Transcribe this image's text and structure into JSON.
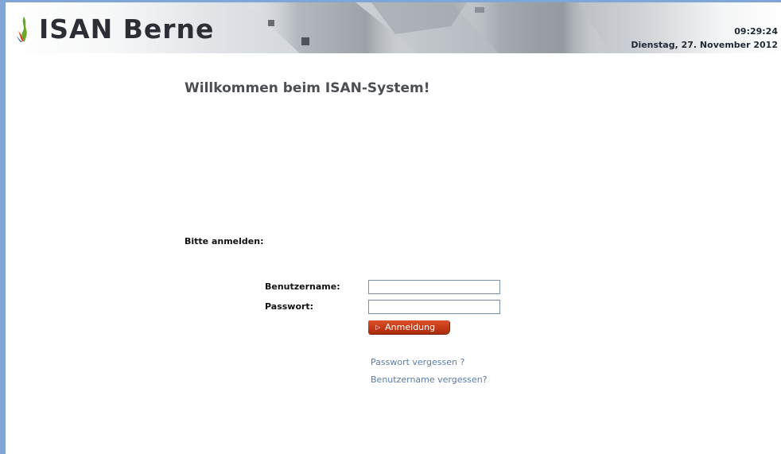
{
  "header": {
    "logo_text": "ISAN Berne",
    "time": "09:29:24",
    "date": "Dienstag, 27. November 2012"
  },
  "main": {
    "welcome": "Willkommen beim ISAN-System!",
    "login_prompt": "Bitte anmelden:"
  },
  "login_form": {
    "username_label": "Benutzername:",
    "username_value": "",
    "password_label": "Passwort:",
    "password_value": "",
    "submit_label": "Anmeldung"
  },
  "links": {
    "forgot_password": "Passwort vergessen ?",
    "forgot_username": "Benutzername vergessen?"
  },
  "colors": {
    "frame_accent": "#7fa6d6",
    "button": "#c43a16",
    "link": "#5a7da4"
  }
}
